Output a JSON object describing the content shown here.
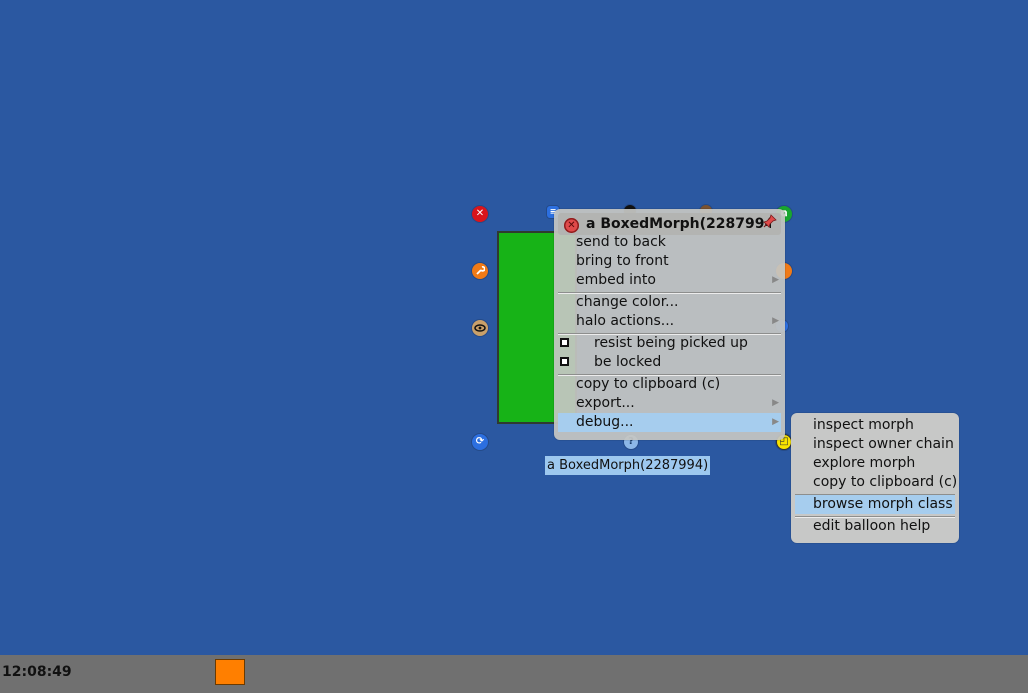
{
  "desktop": {
    "background": "#2b58a1"
  },
  "morph": {
    "color": "#17b317",
    "label": "a BoxedMorph(2287994)"
  },
  "halo_handles": [
    {
      "name": "dismiss-handle-icon",
      "color": "#d9141b",
      "glyph": "✕"
    },
    {
      "name": "menu-handle-icon",
      "color": "#2c6fe0",
      "glyph": "≡"
    },
    {
      "name": "pickup-handle-icon",
      "color": "#111111",
      "glyph": ""
    },
    {
      "name": "move-handle-icon",
      "color": "#7a5230",
      "glyph": ""
    },
    {
      "name": "duplicate-handle-icon",
      "color": "#19a62f",
      "glyph": "⧉"
    },
    {
      "name": "debug-handle-icon",
      "color": "#f07a17",
      "glyph": "🔧"
    },
    {
      "name": "collapse-handle-icon",
      "color": "#f07a17",
      "glyph": ""
    },
    {
      "name": "eye-handle-icon",
      "color": "#c9a06a",
      "glyph": "👁"
    },
    {
      "name": "scale-handle-icon",
      "color": "#2c6fe0",
      "glyph": ""
    },
    {
      "name": "rotate-handle-icon",
      "color": "#2c6fe0",
      "glyph": "⟳"
    },
    {
      "name": "help-handle-icon",
      "color": "#8cb7e8",
      "glyph": "?"
    },
    {
      "name": "resize-handle-icon",
      "color": "#f7e300",
      "glyph": "◰"
    }
  ],
  "halo_menu": {
    "title": "a BoxedMorph(2287994)",
    "items": {
      "send_to_back": "send to back",
      "bring_to_front": "bring to front",
      "embed_into": "embed into",
      "change_color": "change color...",
      "halo_actions": "halo actions...",
      "resist_picked_up": "resist being picked up",
      "be_locked": "be locked",
      "copy_clipboard": "copy to clipboard (c)",
      "export": "export...",
      "debug": "debug..."
    },
    "arrow": "▶"
  },
  "debug_menu": {
    "items": {
      "inspect_morph": "inspect morph",
      "inspect_owner_chain": "inspect owner chain",
      "explore_morph": "explore morph",
      "copy_clipboard": "copy to clipboard (c)",
      "browse_morph_class": "browse morph class",
      "edit_balloon_help": "edit balloon help"
    }
  },
  "taskbar": {
    "clock": "12:08:49",
    "task_color": "#ff7f00"
  }
}
